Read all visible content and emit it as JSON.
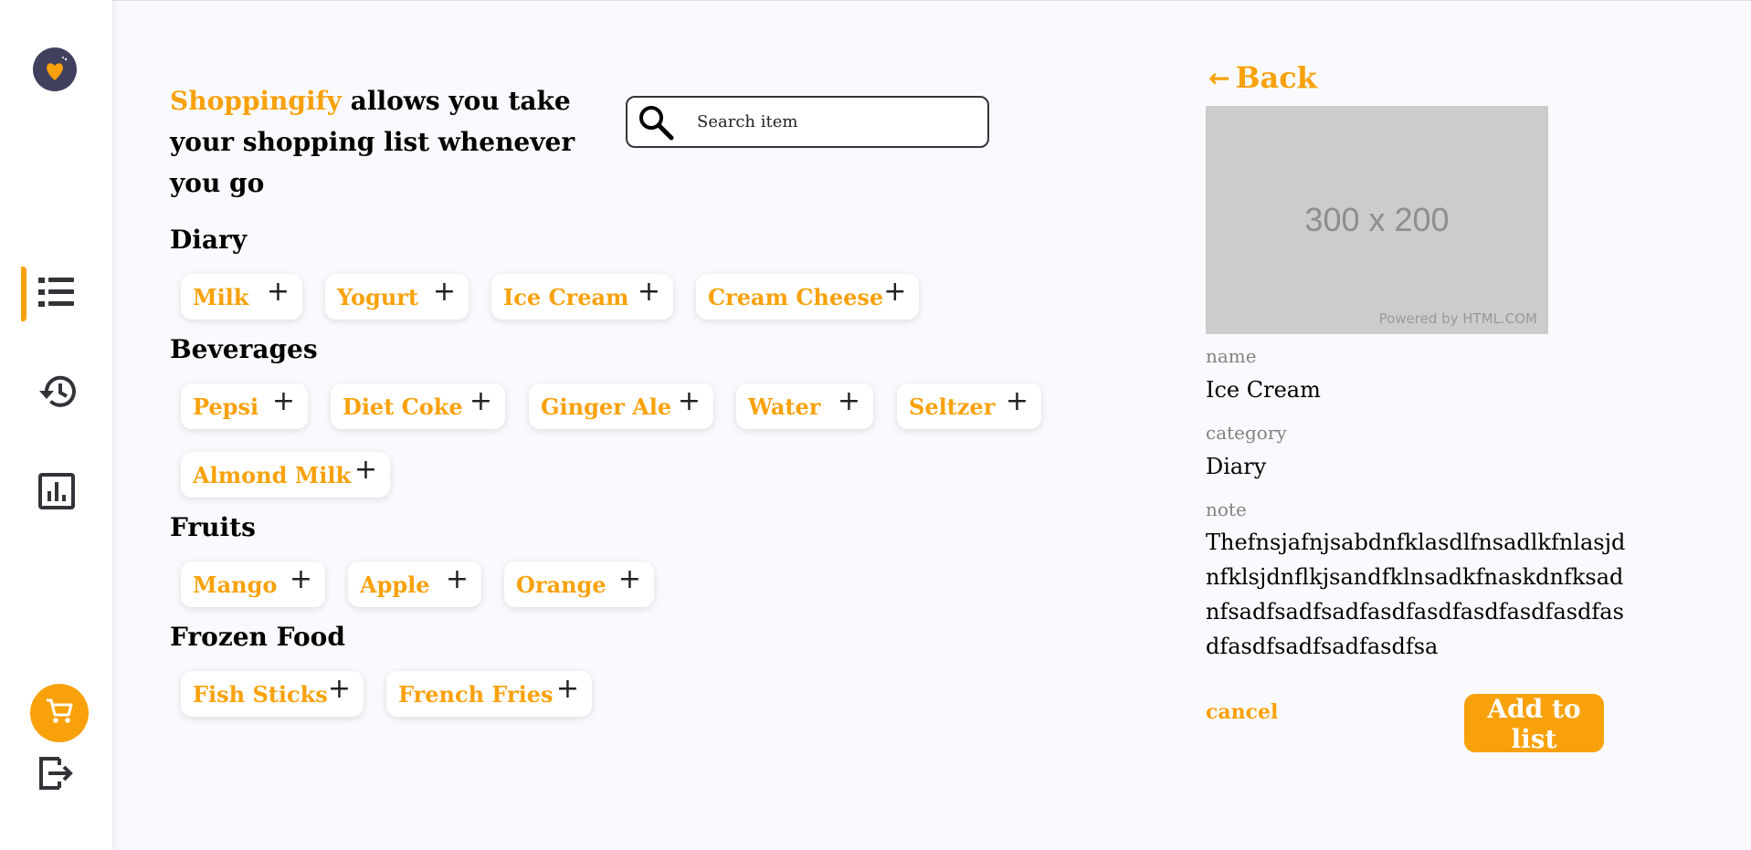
{
  "brand": {
    "name": "Shoppingify",
    "tagline": " allows you take your shopping list whenever you go"
  },
  "search": {
    "placeholder": "Search item"
  },
  "sidebar": {
    "logo_icon": "logo-icon",
    "nav": [
      {
        "name": "items",
        "icon": "list-icon",
        "active": true
      },
      {
        "name": "history",
        "icon": "history-icon",
        "active": false
      },
      {
        "name": "statistics",
        "icon": "chart-icon",
        "active": false
      }
    ],
    "cart_icon": "cart-icon",
    "logout_icon": "logout-icon"
  },
  "categories": [
    {
      "title": "Diary",
      "items": [
        "Milk",
        "Yogurt",
        "Ice Cream",
        "Cream Cheese"
      ]
    },
    {
      "title": "Beverages",
      "items": [
        "Pepsi",
        "Diet Coke",
        "Ginger Ale",
        "Water",
        "Seltzer",
        "Almond Milk"
      ]
    },
    {
      "title": "Fruits",
      "items": [
        "Mango",
        "Apple",
        "Orange"
      ]
    },
    {
      "title": "Frozen Food",
      "items": [
        "Fish Sticks",
        "French Fries"
      ]
    }
  ],
  "plus_symbol": "+",
  "detail": {
    "back_label": "Back",
    "image_dims": "300 x 200",
    "image_credit": "Powered by HTML.COM",
    "name_label": "name",
    "name_value": "Ice Cream",
    "category_label": "category",
    "category_value": "Diary",
    "note_label": "note",
    "note_value": "Thefnsjafnjsabdnfklasdlfnsadlkfnlasjdnfklsjdnflkjsandfklnsadkfnaskdnfksadnfsadfsadfsadfasdfasdfasdfasdfasdfasdfasdfsadfsadfasdfsa",
    "cancel_label": "cancel",
    "add_label": "Add to list"
  },
  "colors": {
    "accent": "#F9A10A",
    "logo_bg": "#40405E",
    "background": "#FAFAFE"
  }
}
